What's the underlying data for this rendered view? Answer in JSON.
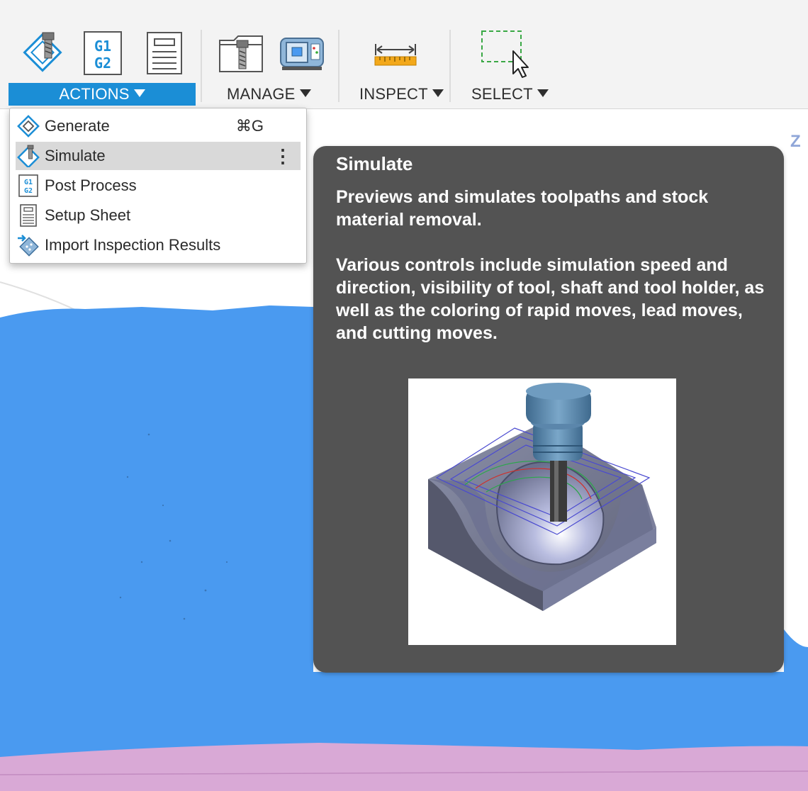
{
  "toolbar": {
    "groups": [
      {
        "label": "ACTIONS",
        "active": true
      },
      {
        "label": "MANAGE",
        "active": false
      },
      {
        "label": "INSPECT",
        "active": false
      },
      {
        "label": "SELECT",
        "active": false
      }
    ],
    "icons": {
      "generate": "generate-tool-icon",
      "post_process": "g1-g2-post-icon",
      "setup_sheet": "setup-sheet-icon",
      "tool_library": "tool-library-icon",
      "machine_library": "machine-library-icon",
      "measure": "measure-ruler-icon",
      "select": "selection-box-icon"
    },
    "g1": "G1",
    "g2": "G2"
  },
  "menu": {
    "items": [
      {
        "label": "Generate",
        "shortcut": "⌘G",
        "icon": "generate-icon",
        "highlighted": false
      },
      {
        "label": "Simulate",
        "more": "⋮",
        "icon": "simulate-icon",
        "highlighted": true
      },
      {
        "label": "Post Process",
        "icon": "post-process-icon",
        "highlighted": false
      },
      {
        "label": "Setup Sheet",
        "icon": "setup-sheet-icon",
        "highlighted": false
      },
      {
        "label": "Import Inspection Results",
        "icon": "import-inspection-icon",
        "highlighted": false
      }
    ]
  },
  "tooltip": {
    "title": "Simulate",
    "paragraph1": "Previews and simulates toolpaths and stock material removal.",
    "paragraph2": "Various controls include simulation speed and direction, visibility of tool, shaft and tool holder, as well as the coloring of rapid moves, lead moves, and cutting moves.",
    "image": "simulation-preview-illustration"
  },
  "viewport": {
    "view_cube_axis": "Z",
    "stock_color": "#4a9af0",
    "accent_color": "#1b8ed6"
  }
}
